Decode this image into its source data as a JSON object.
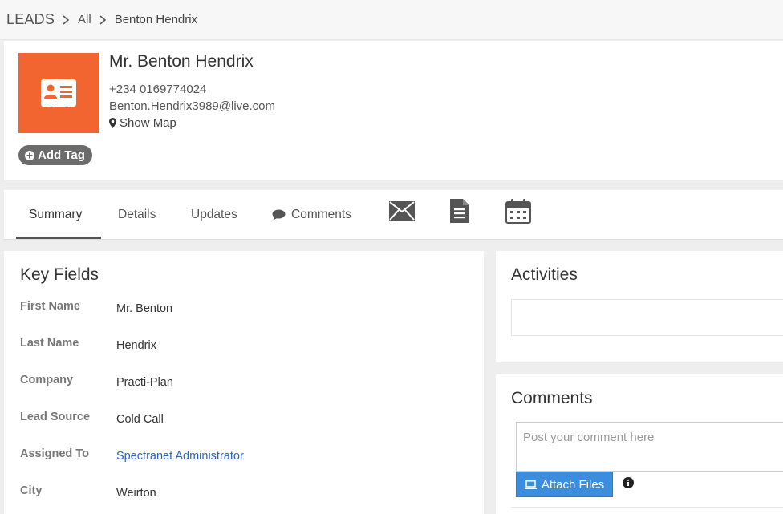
{
  "breadcrumb": {
    "root": "LEADS",
    "items": [
      "All",
      "Benton Hendrix"
    ]
  },
  "lead": {
    "name": "Mr. Benton Hendrix",
    "phone": "+234 0169774024",
    "email": "Benton.Hendrix3989@live.com",
    "show_map": "Show Map",
    "add_tag": "Add Tag",
    "avatar_color": "#f26430"
  },
  "tabs": {
    "summary": "Summary",
    "details": "Details",
    "updates": "Updates",
    "comments": "Comments",
    "icons": [
      "mail-icon",
      "document-icon",
      "calendar-icon"
    ]
  },
  "key_fields": {
    "title": "Key Fields",
    "rows": [
      {
        "label": "First Name",
        "value": "Mr. Benton"
      },
      {
        "label": "Last Name",
        "value": "Hendrix"
      },
      {
        "label": "Company",
        "value": "Practi-Plan"
      },
      {
        "label": "Lead Source",
        "value": "Cold Call"
      },
      {
        "label": "Assigned To",
        "value": "Spectranet Administrator"
      },
      {
        "label": "City",
        "value": "Weirton"
      }
    ]
  },
  "activities": {
    "title": "Activities"
  },
  "comments": {
    "title": "Comments",
    "placeholder": "Post your comment here",
    "attach_label": "Attach Files"
  },
  "colors": {
    "accent": "#3c8dde",
    "link": "#2a63c2",
    "tag_bg": "#6b6b6b"
  }
}
